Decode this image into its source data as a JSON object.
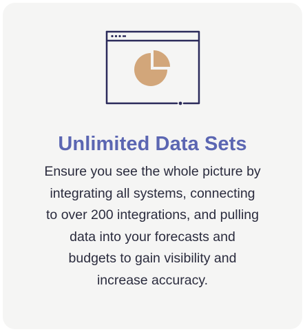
{
  "card": {
    "icon": "browser-window-pie-chart-icon",
    "title": "Unlimited Data Sets",
    "description_lines": [
      "Ensure you see the whole picture by",
      "integrating all systems, connecting",
      "to over 200 integrations, and pulling",
      "data into your forecasts and",
      "budgets to gain visibility and",
      "increase accuracy."
    ]
  },
  "colors": {
    "card_background": "#f5f5f4",
    "title": "#5b66b2",
    "text": "#2a2b3d",
    "icon_stroke": "#2b2a5a",
    "pie_fill": "#d2a67a"
  }
}
